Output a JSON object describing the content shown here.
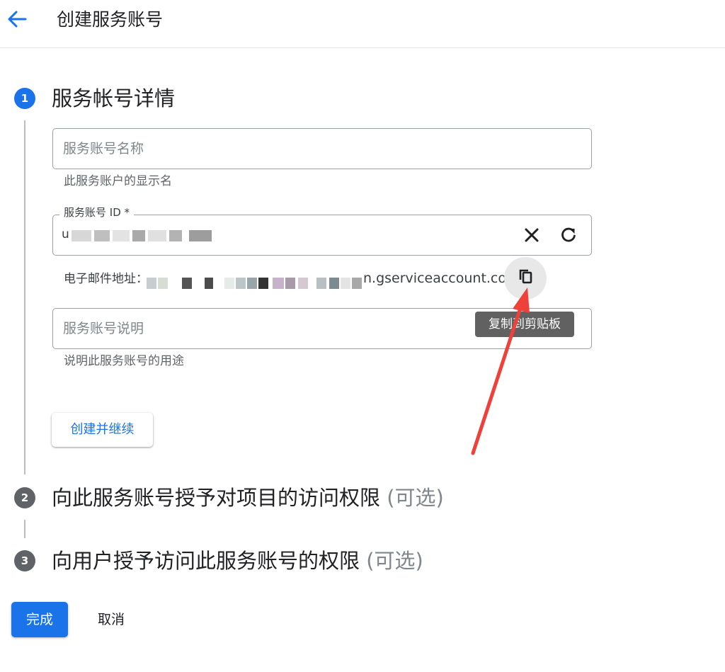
{
  "header": {
    "title": "创建服务账号",
    "back_icon": "arrow-left-icon"
  },
  "colors": {
    "accent": "#1a73e8",
    "inactive_step": "#5f6368",
    "annotation_arrow": "#f0403a"
  },
  "steps": [
    {
      "number": "1",
      "title": "服务帐号详情",
      "optional": ""
    },
    {
      "number": "2",
      "title": "向此服务账号授予对项目的访问权限",
      "optional": "(可选)"
    },
    {
      "number": "3",
      "title": "向用户授予访问此服务账号的权限",
      "optional": "(可选)"
    }
  ],
  "form": {
    "name_field": {
      "placeholder": "服务账号名称",
      "hint": "此服务账户的显示名"
    },
    "id_field": {
      "label": "服务账号 ID *",
      "value_prefix": "u",
      "clear_icon": "close-icon",
      "refresh_icon": "refresh-icon"
    },
    "email": {
      "label": "电子邮件地址：",
      "suffix": "n.gserviceaccount.com",
      "copy_icon": "copy-icon",
      "tooltip": "复制到剪贴板"
    },
    "description_field": {
      "placeholder": "服务账号说明",
      "hint": "说明此服务账号的用途"
    },
    "create_button": "创建并继续"
  },
  "footer": {
    "done_button": "完成",
    "cancel_button": "取消"
  }
}
